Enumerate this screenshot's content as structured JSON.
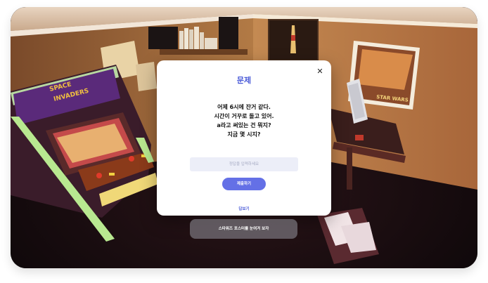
{
  "modal": {
    "title": "문제",
    "close_symbol": "✕",
    "question_lines": [
      "어제 6시에 잔거 같다.",
      "시간이 거꾸로 돌고 있어.",
      "a라고 써있는 건 뭐지?",
      "지금 몇 시지?"
    ],
    "answer_placeholder": "정답을 입력하세요",
    "answer_value": "",
    "submit_label": "제출하기",
    "answer_link_label": "답보기"
  },
  "hint_button_label": "스타워즈 포스터를 눈여겨 보자",
  "scene": {
    "arcade_marquee_line1": "SPACE",
    "arcade_marquee_line2": "INVADERS",
    "poster_title": "STAR WARS",
    "icons": [
      "arcade-cabinet",
      "star-wars-poster",
      "lightsaber-poster",
      "keyboard",
      "bookshelf",
      "speaker"
    ]
  },
  "colors": {
    "accent": "#6470e6",
    "title": "#4b5bd8",
    "input_bg": "#eceef8",
    "hint_bg": "#96969e"
  }
}
